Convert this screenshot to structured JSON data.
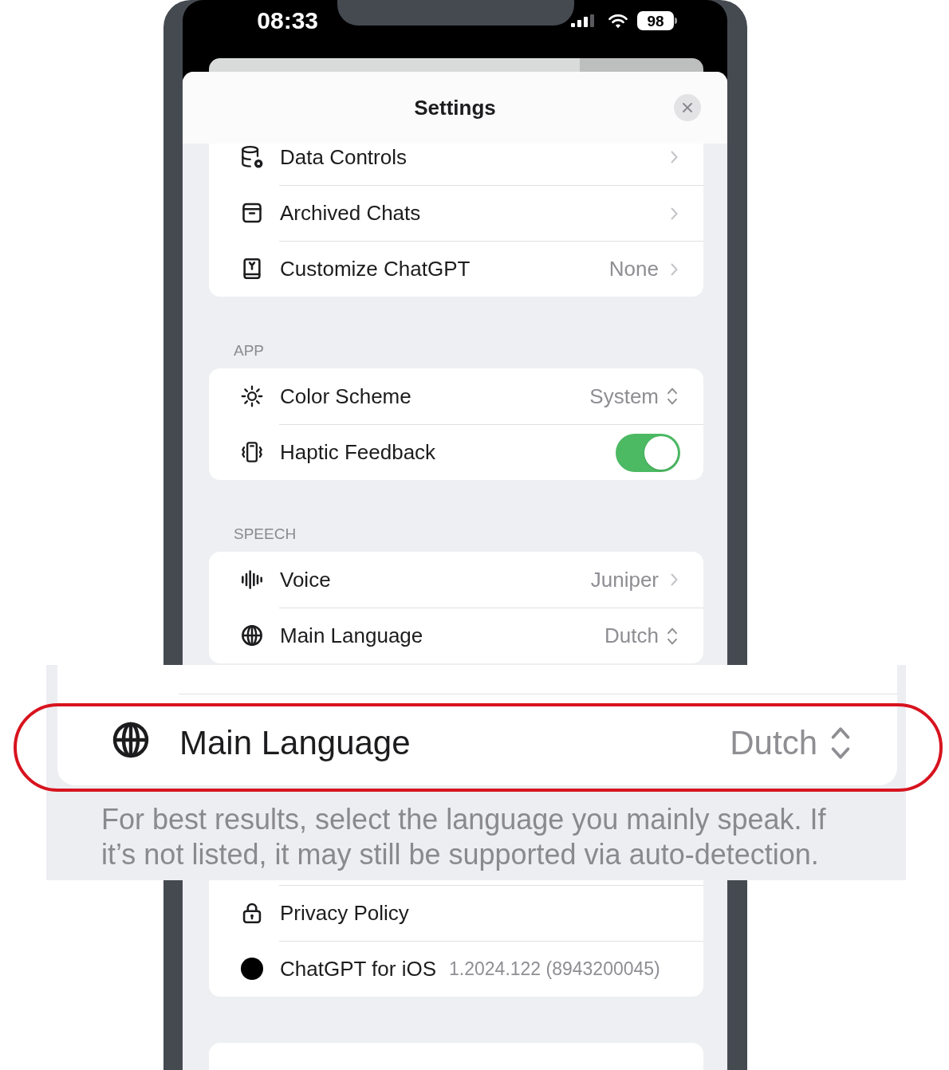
{
  "status_bar": {
    "time": "08:33",
    "battery": "98"
  },
  "sheet": {
    "title": "Settings",
    "sections": [
      {
        "rows": [
          {
            "kind": "link",
            "label": "Data Controls"
          },
          {
            "kind": "link",
            "label": "Archived Chats"
          },
          {
            "kind": "link",
            "label": "Customize ChatGPT",
            "value": "None"
          }
        ]
      },
      {
        "header": "APP",
        "rows": [
          {
            "kind": "picker",
            "label": "Color Scheme",
            "value": "System"
          },
          {
            "kind": "toggle",
            "label": "Haptic Feedback",
            "on": true
          }
        ]
      },
      {
        "header": "SPEECH",
        "rows": [
          {
            "kind": "link",
            "label": "Voice",
            "value": "Juniper"
          },
          {
            "kind": "picker",
            "label": "Main Language",
            "value": "Dutch"
          }
        ]
      }
    ]
  },
  "callout": {
    "highlighted": true,
    "row": {
      "kind": "picker",
      "label": "Main Language",
      "value": "Dutch"
    },
    "footer": "For best results, select the language you mainly speak. If it’s not listed, it may still be supported via auto-detection."
  },
  "lower_sections": [
    {
      "rows": [
        {
          "kind": "plain",
          "label": "Privacy Policy"
        },
        {
          "kind": "info",
          "label": "ChatGPT for iOS",
          "value": "1.2024.122 (8943200045)"
        }
      ]
    }
  ]
}
